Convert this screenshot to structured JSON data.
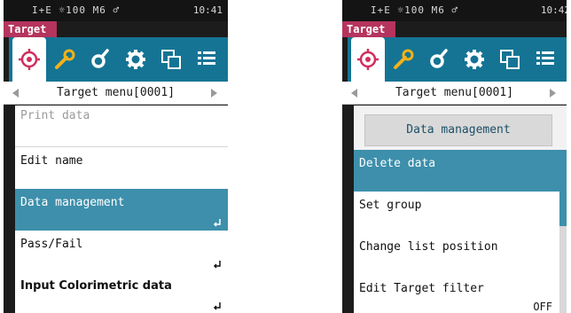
{
  "left": {
    "status": {
      "indicators": "I+E ☼100 M6 ♂",
      "time": "10:41"
    },
    "tab_label": "Target",
    "icons": [
      "target-icon",
      "wrench-icon",
      "probe-icon",
      "gear-icon",
      "copy-icon",
      "list-icon"
    ],
    "nav": {
      "title": "Target menu[0001]"
    },
    "menu": [
      {
        "label": "Print data",
        "state": "disabled"
      },
      {
        "label": "Edit name",
        "state": "normal"
      },
      {
        "label": "Data management",
        "state": "selected",
        "enter": true
      },
      {
        "label": "Pass/Fail",
        "state": "normal",
        "enter": true
      },
      {
        "label": "Input Colorimetric data",
        "state": "normal",
        "enter": true
      }
    ]
  },
  "right": {
    "status": {
      "indicators": "I+E ☼100 M6 ♂",
      "time": "10:42"
    },
    "tab_label": "Target",
    "nav": {
      "title": "Target menu[0001]"
    },
    "header": "Data management",
    "menu": [
      {
        "label": "Delete data",
        "state": "selected"
      },
      {
        "label": "Set group",
        "state": "normal"
      },
      {
        "label": "Change list position",
        "state": "normal"
      },
      {
        "label": "Edit Target filter",
        "state": "normal",
        "value": "OFF"
      }
    ]
  },
  "colors": {
    "icon_bar": "#157494",
    "selected_row": "#3d8fab",
    "tab_label_bg": "#b5345d",
    "screen_bg": "#1c1c1c"
  }
}
